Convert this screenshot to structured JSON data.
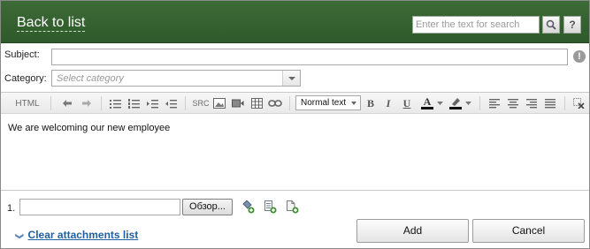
{
  "header": {
    "back_label": "Back to list",
    "search_placeholder": "Enter the text for search",
    "help_label": "?"
  },
  "form": {
    "subject_label": "Subject:",
    "subject_value": "",
    "warn_symbol": "!",
    "category_label": "Category:",
    "category_placeholder": "Select category"
  },
  "toolbar": {
    "html_label": "HTML",
    "src_label": "SRC",
    "style_value": "Normal text",
    "bold": "B",
    "italic": "I",
    "underline": "U",
    "font_color_letter": "A"
  },
  "editor": {
    "body_text": "We are welcoming our new employee"
  },
  "attachments": {
    "index_label": "1.",
    "browse_label": "Обзор...",
    "clear_label": "Clear attachments list"
  },
  "actions": {
    "add_label": "Add",
    "cancel_label": "Cancel"
  },
  "colors": {
    "header_green": "#355f30",
    "link_blue": "#1f5fa3"
  }
}
